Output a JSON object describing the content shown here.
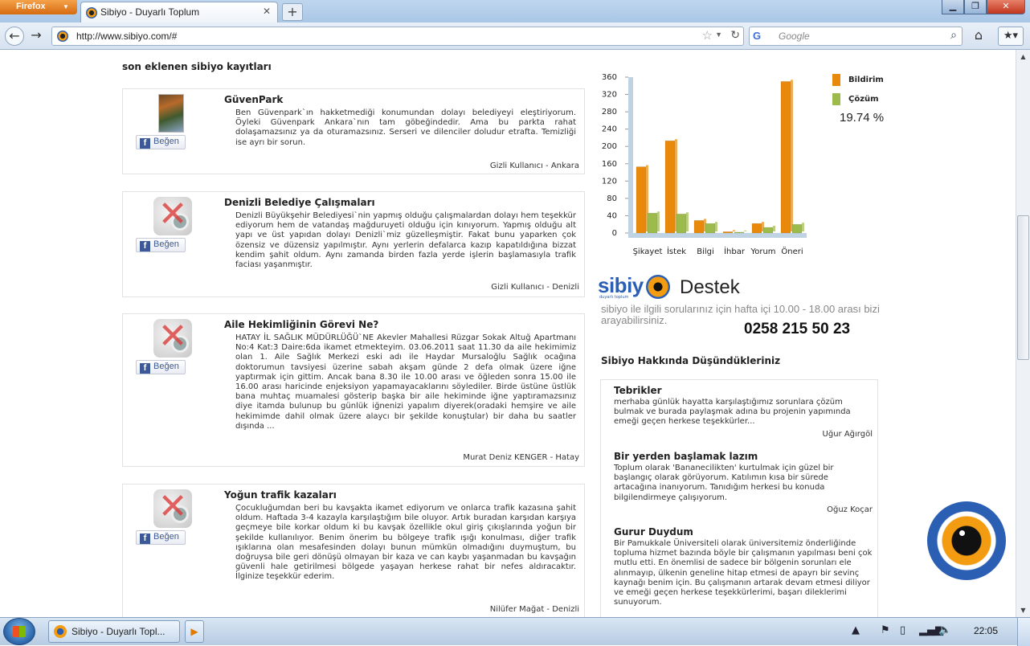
{
  "browser": {
    "menu_label": "Firefox",
    "tab_title": "Sibiyo - Duyarlı Toplum",
    "url": "http://www.sibiyo.com/#",
    "search_placeholder": "Google",
    "search_engine_icon": "G"
  },
  "feed": {
    "heading": "son eklenen sibiyo kayıtları",
    "like_label": "Beğen",
    "cards": [
      {
        "title": "GüvenPark",
        "body": "Ben Güvenpark`ın hakketmediği konumundan dolayı belediyeyi eleştiriyorum. Öyleki Güvenpark Ankara`nın tam göbeğindedir. Ama bu parkta rahat dolaşamazsınız ya da oturamazsınız. Serseri ve dilenciler doludur etrafta. Temizliği ise ayrı bir sorun.",
        "author": "Gizli Kullanıcı - Ankara"
      },
      {
        "title": "Denizli Belediye Çalışmaları",
        "body": "Denizli Büyükşehir Belediyesi`nin yapmış olduğu çalışmalardan dolayı hem teşekkür ediyorum hem de vatandaş mağduruyeti olduğu için kınıyorum. Yapmış olduğu alt yapı ve üst yapıdan dolayı Denizli`miz güzelleşmiştir. Fakat bunu yaparken çok özensiz ve düzensiz yapılmıştır. Aynı yerlerin defalarca kazıp kapatıldığına bizzat kendim şahit oldum. Aynı zamanda birden fazla yerde işlerin başlamasıyla trafik faciası yaşanmıştır.",
        "author": "Gizli Kullanıcı - Denizli"
      },
      {
        "title": "Aile Hekimliğinin Görevi Ne?",
        "body": "HATAY İL SAĞLIK MÜDÜRLÜĞÜ`NE Akevler Mahallesi Rüzgar Sokak Altuğ Apartmanı No:4 Kat:3 Daire:6da ikamet etmekteyim. 03.06.2011 saat 11.30 da aile hekimimiz olan 1. Aile Sağlık Merkezi eski adı ile Haydar Mursaloğlu Sağlık ocağına doktorumun tavsiyesi üzerine sabah akşam günde 2 defa olmak üzere iğne yaptırmak için gittim. Ancak bana 8.30 ile 10.00 arası ve öğleden sonra 15.00 ile 16.00 arası haricinde enjeksiyon yapamayacaklarını söylediler. Birde üstüne üstlük bana muhtaç muamalesi gösterip başka bir aile hekiminde iğne yaptıramazsınız diye itamda bulunup bu günlük iğnenizi yapalım diyerek(oradaki hemşire ve aile hekimimde dahil olmak üzere alaycı bir şekilde konuştular) bir daha bu saatler dışında ...",
        "author": "Murat Deniz KENGER - Hatay"
      },
      {
        "title": "Yoğun trafik kazaları",
        "body": "Çocukluğumdan beri bu kavşakta ikamet ediyorum ve onlarca trafik kazasına şahit oldum. Haftada 3-4 kazayla karşılaştığım bile oluyor. Artık buradan karşıdan karşıya geçmeye bile korkar oldum ki bu kavşak özellikle okul giriş çıkışlarında yoğun bir şekilde kullanılıyor. Benim önerim bu bölgeye trafik ışığı konulması, diğer trafik ışıklarına olan mesafesinden dolayı bunun mümkün olmadığını duymuştum, bu doğruysa bile geri dönüşü olmayan bir kaza ve can kaybı yaşanmadan bu kavşağın güvenli hale getirilmesi bölgede yaşayan herkese rahat bir nefes aldıracaktır. İlginize teşekkür ederim.",
        "author": "Nilüfer Mağat - Denizli"
      }
    ]
  },
  "chart_data": {
    "type": "bar",
    "categories": [
      "Şikayet",
      "İstek",
      "Bilgi",
      "İhbar",
      "Yorum",
      "Öneri"
    ],
    "series": [
      {
        "name": "Bildirim",
        "values": [
          153,
          213,
          29,
          3,
          22,
          350
        ]
      },
      {
        "name": "Çözüm",
        "values": [
          46,
          44,
          22,
          2,
          13,
          20
        ]
      }
    ],
    "yticks": [
      0,
      40,
      80,
      120,
      160,
      200,
      240,
      280,
      320,
      360
    ],
    "ylim": [
      0,
      360
    ],
    "legend_position": "right",
    "colors": {
      "Bildirim": "#e8890c",
      "Çözüm": "#9dbb4c",
      "grid": "#c0d3e2"
    },
    "annotation": "19.74 %"
  },
  "support": {
    "logo_text": "sibiy",
    "logo_tagline": "duyarlı toplum",
    "title": "Destek",
    "info": "sibiyo ile ilgili sorularınız için hafta içi 10.00 - 18.00 arası bizi arayabilirsiniz.",
    "phone": "0258 215 50 23"
  },
  "opinions": {
    "heading": "Sibiyo Hakkında Düşündükleriniz",
    "items": [
      {
        "title": "Tebrikler",
        "body": "merhaba günlük hayatta karşılaştığımız sorunlara çözüm bulmak ve burada paylaşmak adına bu projenin yapımında emeği geçen herkese teşekkürler...",
        "author": "Uğur Ağırgöl"
      },
      {
        "title": "Bir yerden başlamak lazım",
        "body": "Toplum olarak 'Bananecilikten' kurtulmak için güzel bir başlangıç olarak görüyorum. Katılımın kısa bir sürede artacağına inanıyorum. Tanıdığım herkesi bu konuda bilgilendirmeye çalışıyorum.",
        "author": "Oğuz Koçar"
      },
      {
        "title": "Gurur Duydum",
        "body": "Bir Pamukkale Üniversiteli olarak üniversitemiz önderliğinde topluma hizmet bazında böyle bir çalışmanın yapılması beni çok mutlu etti. En önemlisi de sadece bir bölgenin sorunları ele alınmayıp, ülkenin geneline hitap etmesi de apayrı bir sevinç kaynağı benim için. Bu çalışmanın artarak devam etmesi diliyor ve emeği geçen herkese teşekkürlerimi, başarı dileklerimi sunuyorum.",
        "author": ""
      }
    ]
  },
  "taskbar": {
    "firefox_task": "Sibiyo - Duyarlı Topl...",
    "clock": "22:05"
  }
}
